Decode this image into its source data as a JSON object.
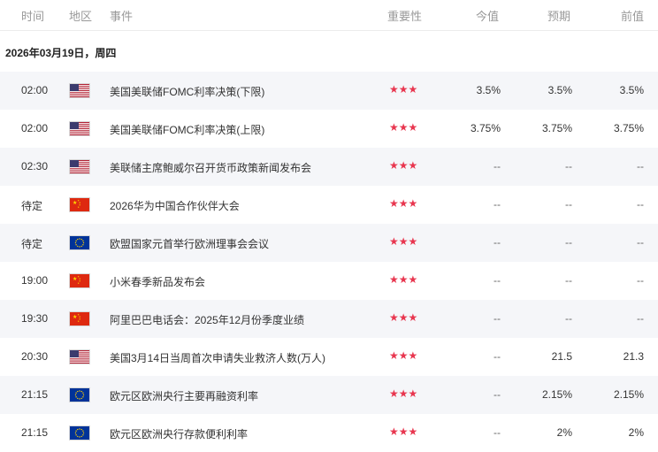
{
  "header": {
    "time": "时间",
    "region": "地区",
    "event": "事件",
    "importance": "重要性",
    "actual": "今值",
    "forecast": "预期",
    "previous": "前值"
  },
  "date_label": "2026年03月19日，周四",
  "colors": {
    "star": "#e8364f",
    "row_shade": "#f5f6f9"
  },
  "rows": [
    {
      "time": "02:00",
      "region": "us-flag",
      "event": "美国美联储FOMC利率决策(下限)",
      "stars": "★★★",
      "actual": "3.5%",
      "forecast": "3.5%",
      "previous": "3.5%"
    },
    {
      "time": "02:00",
      "region": "us-flag",
      "event": "美国美联储FOMC利率决策(上限)",
      "stars": "★★★",
      "actual": "3.75%",
      "forecast": "3.75%",
      "previous": "3.75%"
    },
    {
      "time": "02:30",
      "region": "us-flag",
      "event": "美联储主席鲍威尔召开货币政策新闻发布会",
      "stars": "★★★",
      "actual": "--",
      "forecast": "--",
      "previous": "--"
    },
    {
      "time": "待定",
      "region": "cn-flag",
      "event": "2026华为中国合作伙伴大会",
      "stars": "★★★",
      "actual": "--",
      "forecast": "--",
      "previous": "--"
    },
    {
      "time": "待定",
      "region": "eu-flag",
      "event": "欧盟国家元首举行欧洲理事会会议",
      "stars": "★★★",
      "actual": "--",
      "forecast": "--",
      "previous": "--"
    },
    {
      "time": "19:00",
      "region": "cn-flag",
      "event": "小米春季新品发布会",
      "stars": "★★★",
      "actual": "--",
      "forecast": "--",
      "previous": "--"
    },
    {
      "time": "19:30",
      "region": "cn-flag",
      "event": "阿里巴巴电话会：2025年12月份季度业绩",
      "stars": "★★★",
      "actual": "--",
      "forecast": "--",
      "previous": "--"
    },
    {
      "time": "20:30",
      "region": "us-flag",
      "event": "美国3月14日当周首次申请失业救济人数(万人)",
      "stars": "★★★",
      "actual": "--",
      "forecast": "21.5",
      "previous": "21.3"
    },
    {
      "time": "21:15",
      "region": "eu-flag",
      "event": "欧元区欧洲央行主要再融资利率",
      "stars": "★★★",
      "actual": "--",
      "forecast": "2.15%",
      "previous": "2.15%"
    },
    {
      "time": "21:15",
      "region": "eu-flag",
      "event": "欧元区欧洲央行存款便利利率",
      "stars": "★★★",
      "actual": "--",
      "forecast": "2%",
      "previous": "2%"
    }
  ]
}
